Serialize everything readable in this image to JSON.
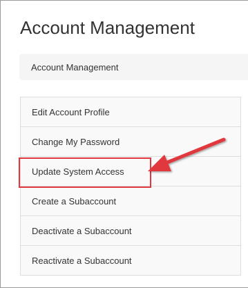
{
  "page": {
    "title": "Account Management"
  },
  "breadcrumb": {
    "label": "Account Management"
  },
  "menu": {
    "items": [
      {
        "label": "Edit Account Profile"
      },
      {
        "label": "Change My Password"
      },
      {
        "label": "Update System Access",
        "highlighted": true
      },
      {
        "label": "Create a Subaccount"
      },
      {
        "label": "Deactivate a Subaccount"
      },
      {
        "label": "Reactivate a Subaccount"
      }
    ]
  },
  "annotation": {
    "color": "#e0383e",
    "icon": "arrow-icon"
  }
}
